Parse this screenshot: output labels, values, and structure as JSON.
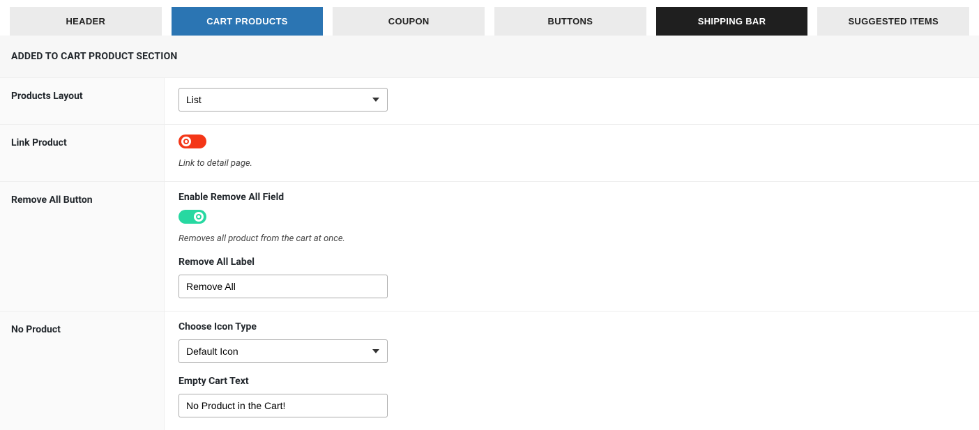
{
  "tabs": {
    "header": "HEADER",
    "cart_products": "CART PRODUCTS",
    "coupon": "COUPON",
    "buttons": "BUTTONS",
    "shipping_bar": "SHIPPING BAR",
    "suggested_items": "SUGGESTED ITEMS"
  },
  "section_title": "ADDED TO CART PRODUCT SECTION",
  "rows": {
    "products_layout": {
      "label": "Products Layout",
      "value": "List"
    },
    "link_product": {
      "label": "Link Product",
      "desc": "Link to detail page."
    },
    "remove_all": {
      "label": "Remove All Button",
      "enable_label": "Enable Remove All Field",
      "desc": "Removes all product from the cart at once.",
      "input_label": "Remove All Label",
      "input_value": "Remove All"
    },
    "no_product": {
      "label": "No Product",
      "icon_label": "Choose Icon Type",
      "icon_value": "Default Icon",
      "empty_label": "Empty Cart Text",
      "empty_value": "No Product in the Cart!"
    }
  }
}
